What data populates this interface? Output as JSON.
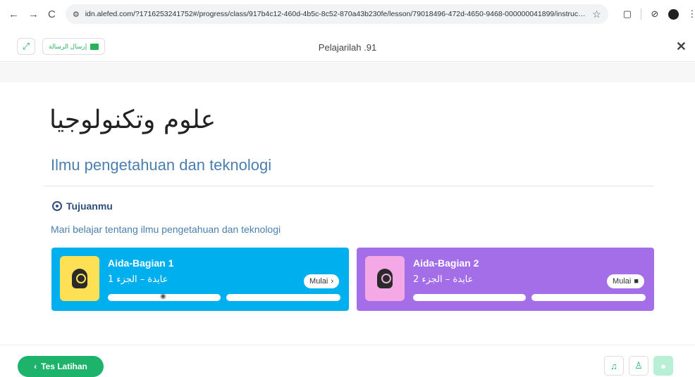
{
  "browser": {
    "back": "←",
    "forward": "→",
    "reload": "C",
    "url": "idn.alefed.com/?1716253241752#/progress/class/917b4c12-460d-4b5c-8c52-870a43b230fe/lesson/79018496-472d-4650-9468-000000041899/instructionalPla...",
    "star": "☆"
  },
  "header": {
    "send_message_label": "إرسال الرسالة",
    "title": "Pelajarilah .91",
    "close": "✕"
  },
  "lesson": {
    "arabic_title": "علوم وتكنولوجيا",
    "subtitle": "Ilmu pengetahuan dan teknologi",
    "goal_label": "Tujuanmu",
    "goal_text": "Mari belajar tentang ilmu pengetahuan dan teknologi"
  },
  "cards": [
    {
      "title": "Aida-Bagian 1",
      "subtitle": "عايدة – الجزء 1",
      "button": "Mulai",
      "button_icon": "›",
      "color": "#00b0ee"
    },
    {
      "title": "Aida-Bagian 2",
      "subtitle": "عايدة – الجزء 2",
      "button": "Mulai",
      "button_icon": "🔒",
      "color": "#a36ee8"
    }
  ],
  "footer": {
    "back_label": "Tes Latihan",
    "back_icon": "‹"
  }
}
